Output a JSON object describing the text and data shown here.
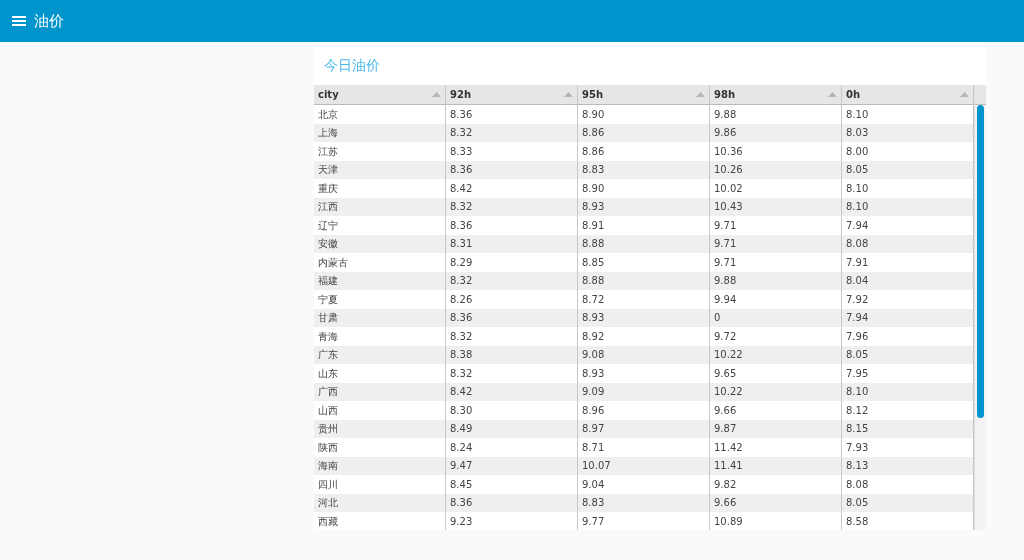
{
  "app_bar": {
    "title": "油价"
  },
  "card": {
    "title": "今日油价"
  },
  "table": {
    "columns": [
      "city",
      "92h",
      "95h",
      "98h",
      "0h"
    ],
    "rows": [
      [
        "北京",
        "8.36",
        "8.90",
        "9.88",
        "8.10"
      ],
      [
        "上海",
        "8.32",
        "8.86",
        "9.86",
        "8.03"
      ],
      [
        "江苏",
        "8.33",
        "8.86",
        "10.36",
        "8.00"
      ],
      [
        "天津",
        "8.36",
        "8.83",
        "10.26",
        "8.05"
      ],
      [
        "重庆",
        "8.42",
        "8.90",
        "10.02",
        "8.10"
      ],
      [
        "江西",
        "8.32",
        "8.93",
        "10.43",
        "8.10"
      ],
      [
        "辽宁",
        "8.36",
        "8.91",
        "9.71",
        "7.94"
      ],
      [
        "安徽",
        "8.31",
        "8.88",
        "9.71",
        "8.08"
      ],
      [
        "内蒙古",
        "8.29",
        "8.85",
        "9.71",
        "7.91"
      ],
      [
        "福建",
        "8.32",
        "8.88",
        "9.88",
        "8.04"
      ],
      [
        "宁夏",
        "8.26",
        "8.72",
        "9.94",
        "7.92"
      ],
      [
        "甘肃",
        "8.36",
        "8.93",
        "0",
        "7.94"
      ],
      [
        "青海",
        "8.32",
        "8.92",
        "9.72",
        "7.96"
      ],
      [
        "广东",
        "8.38",
        "9.08",
        "10.22",
        "8.05"
      ],
      [
        "山东",
        "8.32",
        "8.93",
        "9.65",
        "7.95"
      ],
      [
        "广西",
        "8.42",
        "9.09",
        "10.22",
        "8.10"
      ],
      [
        "山西",
        "8.30",
        "8.96",
        "9.66",
        "8.12"
      ],
      [
        "贵州",
        "8.49",
        "8.97",
        "9.87",
        "8.15"
      ],
      [
        "陕西",
        "8.24",
        "8.71",
        "11.42",
        "7.93"
      ],
      [
        "海南",
        "9.47",
        "10.07",
        "11.41",
        "8.13"
      ],
      [
        "四川",
        "8.45",
        "9.04",
        "9.82",
        "8.08"
      ],
      [
        "河北",
        "8.36",
        "8.83",
        "9.66",
        "8.05"
      ],
      [
        "西藏",
        "9.23",
        "9.77",
        "10.89",
        "8.58"
      ]
    ]
  }
}
